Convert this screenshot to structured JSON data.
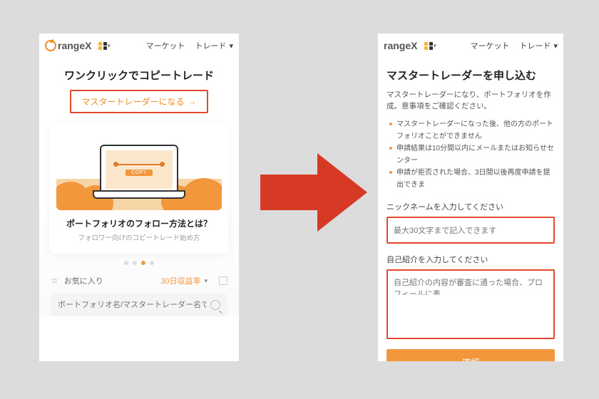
{
  "brand": "rangeX",
  "colors": {
    "accent": "#f3973c",
    "highlight_border": "#e2492d"
  },
  "nav": {
    "market": "マーケット",
    "trade": "トレード"
  },
  "left": {
    "headline": "ワンクリックでコピートレード",
    "cta": "マスタートレーダーになる",
    "laptop_button": "COPY",
    "card_title": "ポートフォリオのフォロー方法とは？",
    "card_sub": "フォロワー向けのコピートレード始め方",
    "favorite": "お気に入り",
    "rate_label": "30日収益率",
    "search_placeholder": "ポートフォリオ名/マスタートレーダー名で検"
  },
  "right": {
    "title": "マスタートレーダーを申し込む",
    "intro": "マスタートレーダーになり、ポートフォリオを作成。意事項をご確認ください。",
    "b1": "マスタートレーダーになった後、他の方のポートフォリオことができません",
    "b2": "申請結果は10分間以内にメールまたはお知らせセンター",
    "b3": "申請が拒否された場合、3日間以後再度申請を提出できま",
    "nick_label": "ニックネームを入力してください",
    "nick_ph": "最大30文字まで記入できます",
    "bio_label": "自己紹介を入力してください",
    "bio_ph": "自己紹介の内容が審査に通った場合、プロフィールに表",
    "confirm": "確認"
  }
}
